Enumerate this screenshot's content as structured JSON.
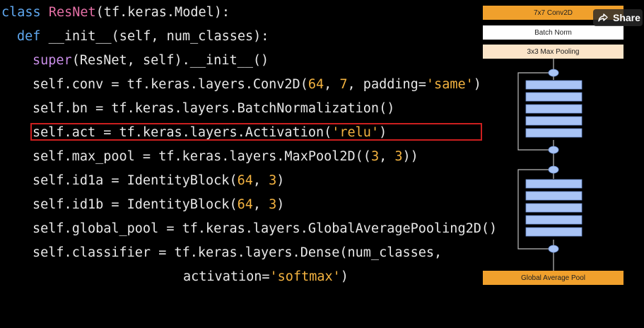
{
  "code": {
    "line1": {
      "kw": "class",
      "name": "ResNet",
      "rest": "(tf.keras.Model):"
    },
    "line2": {
      "kw": "def",
      "rest": "__init__(self, num_classes):"
    },
    "line3": {
      "fn": "super",
      "rest": "(ResNet, self).__init__()"
    },
    "line4": {
      "a": "self.conv = tf.keras.layers.Conv2D(",
      "n1": "64",
      "b": ", ",
      "n2": "7",
      "c": ", padding=",
      "s": "'same'",
      "d": ")"
    },
    "line5": {
      "text": "self.bn = tf.keras.layers.BatchNormalization()"
    },
    "line6": {
      "a": "self.act = tf.keras.layers.Activation(",
      "s": "'relu'",
      "b": ")"
    },
    "line7": {
      "a": "self.max_pool = tf.keras.layers.MaxPool2D((",
      "n1": "3",
      "b": ", ",
      "n2": "3",
      "c": "))"
    },
    "line8": {
      "a": "self.id1a = IdentityBlock(",
      "n1": "64",
      "b": ", ",
      "n2": "3",
      "c": ")"
    },
    "line9": {
      "a": "self.id1b = IdentityBlock(",
      "n1": "64",
      "b": ", ",
      "n2": "3",
      "c": ")"
    },
    "line10": {
      "text": "self.global_pool = tf.keras.layers.GlobalAveragePooling2D()"
    },
    "line11": {
      "text": "self.classifier = tf.keras.layers.Dense(num_classes,"
    },
    "line12": {
      "a": "activation=",
      "s": "'softmax'",
      "b": ")"
    }
  },
  "diagram": {
    "conv_label": "7x7 Conv2D",
    "bn_label": "Batch Norm",
    "pool_label": "3x3 Max Pooling",
    "gap_label": "Global Average Pool"
  },
  "share": {
    "label": "Share",
    "icon": "share-icon"
  },
  "colors": {
    "keyword": "#5fa8f0",
    "class_name": "#e46fa5",
    "builtin": "#c98ee8",
    "number_string": "#f4b340",
    "highlight": "#cc1f1f",
    "conv_orange": "#f0a02c",
    "pool_peach": "#fbe4c8",
    "block_blue": "#a9c4f5"
  }
}
